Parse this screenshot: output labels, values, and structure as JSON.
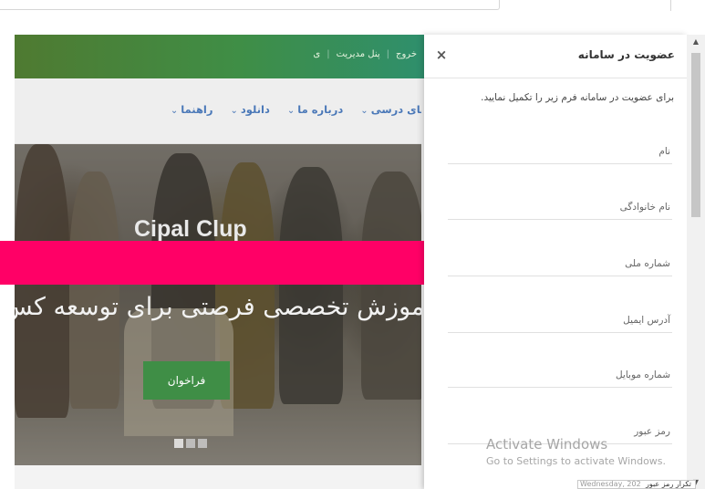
{
  "site": {
    "top_links": [
      "پنل مدیریت",
      "خروج"
    ],
    "top_links_partial": "ی",
    "nav": [
      {
        "label": "های درسی"
      },
      {
        "label": "درباره ما"
      },
      {
        "label": "دانلود"
      },
      {
        "label": "راهنما"
      }
    ],
    "hero_title_en": "Cipal Clup",
    "hero_title_fa": "آموزش تخصصی فرصتی برای توسعه کس",
    "hero_button": "فراخوان"
  },
  "panel": {
    "title": "عضویت در سامانه",
    "close_glyph": "×",
    "intro": "برای عضویت در سامانه فرم زیر را تکمیل نمایید.",
    "fields": [
      {
        "label": "نام"
      },
      {
        "label": "نام خانوادگی"
      },
      {
        "label": "شماره ملی"
      },
      {
        "label": "آدرس ایمیل"
      },
      {
        "label": "شماره موبایل"
      },
      {
        "label": "رمز عبور"
      }
    ],
    "confirm_password_partial": "تکرار رمز عبور"
  },
  "watermark": {
    "line1": "Activate Windows",
    "line2": "Go to Settings to activate Windows."
  },
  "tray": {
    "text": "Wednesday, 202"
  },
  "colors": {
    "brand_green": "#3f8e46",
    "nav_link_blue": "#4a78b8",
    "redaction_magenta": "#ff0066"
  }
}
